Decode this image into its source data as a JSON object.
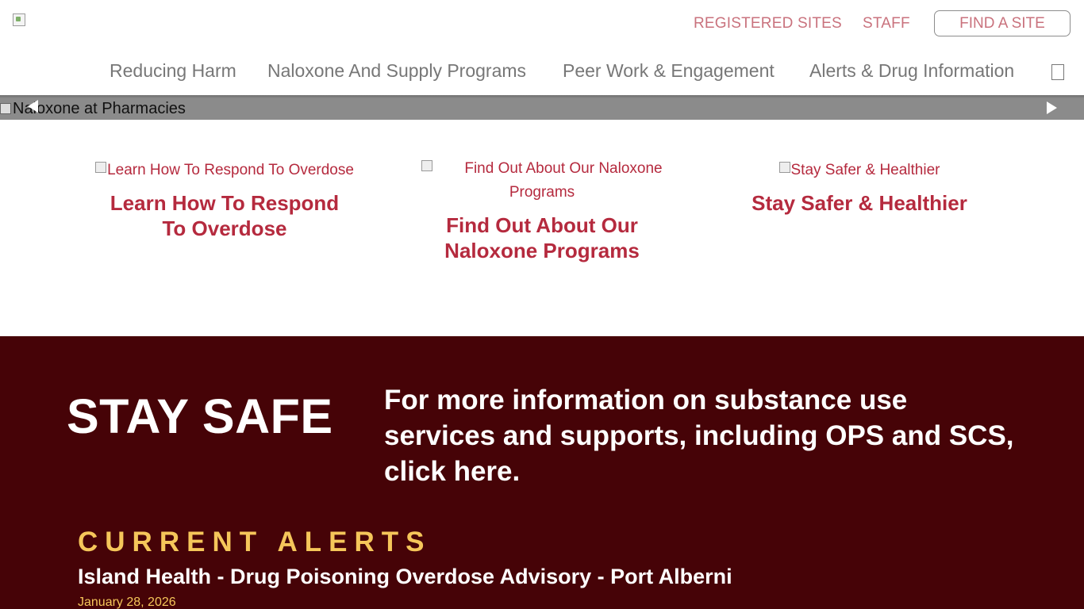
{
  "header": {
    "logo_icon": "broken-image-icon",
    "top_links": [
      "REGISTERED SITES",
      "STAFF"
    ],
    "find_site_label": "FIND A SITE",
    "nav": [
      "Reducing Harm",
      "Naloxone And Supply Programs",
      "Peer Work & Engagement",
      "Alerts & Drug Information"
    ],
    "nav_extra_icon": "box-icon"
  },
  "slider": {
    "label": "Naloxone at Pharmacies",
    "prev_icon": "chevron-left-icon",
    "next_icon": "chevron-right-icon"
  },
  "features": [
    {
      "img_alt": "Learn How To Respond To Overdose",
      "title_line1": "Learn How To Respond",
      "title_line2": "To Overdose"
    },
    {
      "img_alt_line1": "Find Out About Our Naloxone",
      "img_alt_line2": "Programs",
      "title_line1": "Find Out About Our",
      "title_line2": "Naloxone Programs"
    },
    {
      "img_alt": "Stay Safer & Healthier",
      "title_line1": "Stay Safer & Healthier"
    }
  ],
  "stay_safe": {
    "heading": "STAY SAFE",
    "info": "For more information on substance use services and supports, including OPS and SCS, click here."
  },
  "alerts": {
    "heading": "CURRENT ALERTS",
    "items": [
      {
        "title": "Island Health - Drug Poisoning Overdose Advisory - Port Alberni",
        "date": "January 28, 2026"
      }
    ]
  },
  "colors": {
    "accent": "#b52a3e",
    "link_muted": "#c9727d",
    "band": "#460307",
    "alert_gold": "#f5c65a"
  }
}
